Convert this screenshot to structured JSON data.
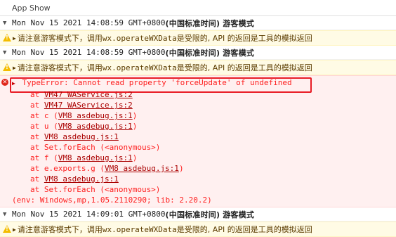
{
  "app": {
    "title": "App Show"
  },
  "groups": [
    {
      "header": {
        "date": "Mon Nov 15 2021 14:08:59 GMT+0800",
        "tz": " (中国标准时间) 游客模式"
      },
      "warn": {
        "cn1": "请注意游客模式下，调用 ",
        "api": "wx.operateWXData",
        "cn2": " 是受限的, API 的返回是工具的模拟返回"
      }
    },
    {
      "header": {
        "date": "Mon Nov 15 2021 14:08:59 GMT+0800",
        "tz": " (中国标准时间) 游客模式"
      },
      "warn": {
        "cn1": "请注意游客模式下，调用 ",
        "api": "wx.operateWXData",
        "cn2": " 是受限的, API 的返回是工具的模拟返回"
      }
    },
    {
      "header": {
        "date": "Mon Nov 15 2021 14:09:01 GMT+0800",
        "tz": " (中国标准时间) 游客模式"
      },
      "warn": {
        "cn1": "请注意游客模式下，调用 ",
        "api": "wx.operateWXData",
        "cn2": " 是受限的, API 的返回是工具的模拟返回"
      }
    }
  ],
  "error": {
    "message": "TypeError: Cannot read property 'forceUpdate' of undefined",
    "stack": [
      {
        "pre": "at ",
        "link": "VM47 WAService.js:2",
        "post": ""
      },
      {
        "pre": "at ",
        "link": "VM47 WAService.js:2",
        "post": ""
      },
      {
        "pre": "at c (",
        "link": "VM8 asdebug.js:1",
        "post": ")"
      },
      {
        "pre": "at u (",
        "link": "VM8 asdebug.js:1",
        "post": ")"
      },
      {
        "pre": "at ",
        "link": "VM8 asdebug.js:1",
        "post": ""
      },
      {
        "pre": "at Set.forEach (<anonymous>)",
        "link": "",
        "post": ""
      },
      {
        "pre": "at f (",
        "link": "VM8 asdebug.js:1",
        "post": ")"
      },
      {
        "pre": "at e.exports.g (",
        "link": "VM8 asdebug.js:1",
        "post": ")"
      },
      {
        "pre": "at ",
        "link": "VM8 asdebug.js:1",
        "post": ""
      },
      {
        "pre": "at Set.forEach (<anonymous>)",
        "link": "",
        "post": ""
      }
    ],
    "env": "(env: Windows,mp,1.05.2110290; lib: 2.20.2)"
  },
  "bottom_warn": {
    "cn1": "请注意游客模式下，调用 ",
    "api": "wx.operateWXData",
    "cn2": " 是受限的, API 的返回是工具的模拟返回"
  },
  "colors": {
    "error_text": "#fe2020",
    "error_bg": "#fff0f0",
    "warn_bg": "#fffbe5",
    "highlight_box": "#e81c25"
  },
  "icons": {
    "caret": "triangle-down-icon",
    "warning": "warning-triangle-icon",
    "error": "error-circle-icon"
  }
}
